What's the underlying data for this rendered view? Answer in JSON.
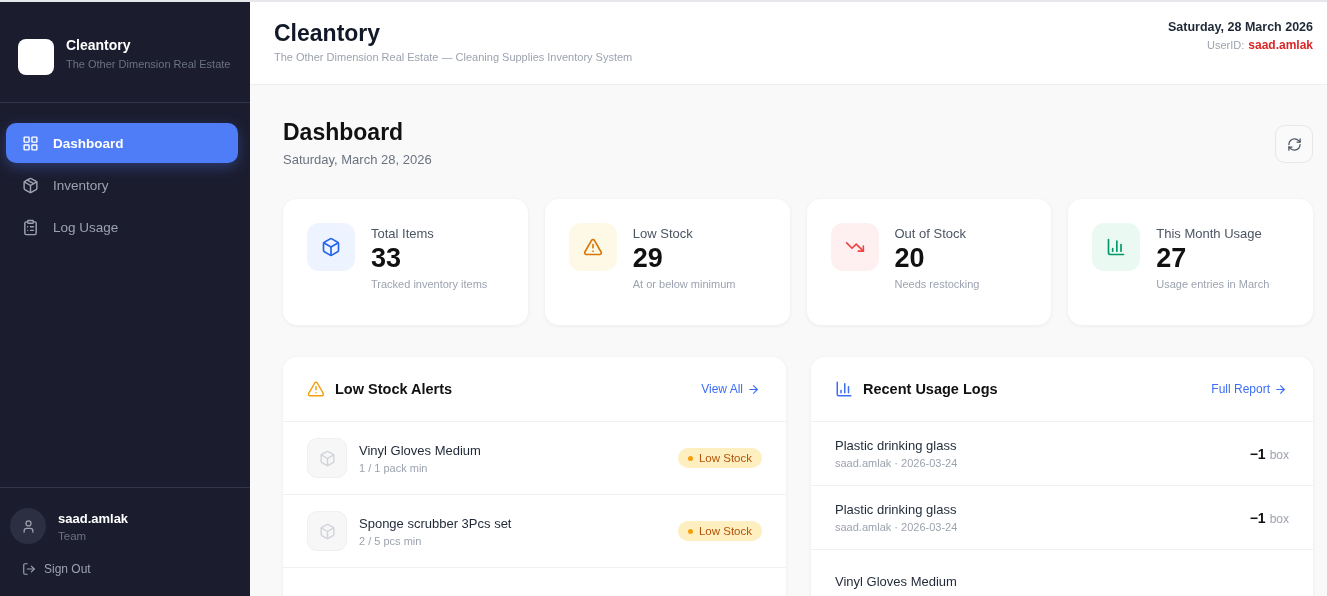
{
  "sidebar": {
    "brand": {
      "name": "Cleantory",
      "subtitle": "The Other Dimension Real Estate"
    },
    "items": [
      {
        "label": "Dashboard",
        "selected": true
      },
      {
        "label": "Inventory",
        "selected": false
      },
      {
        "label": "Log Usage",
        "selected": false
      }
    ],
    "user": {
      "name": "saad.amlak",
      "role": "Team"
    },
    "sign_out": "Sign Out"
  },
  "header": {
    "title": "Cleantory",
    "subtitle": "The Other Dimension Real Estate — Cleaning Supplies Inventory System",
    "date": "Saturday, 28 March 2026",
    "user_label": "UserID:",
    "user_id": "saad.amlak"
  },
  "page": {
    "title": "Dashboard",
    "date": "Saturday, March 28, 2026"
  },
  "stats": [
    {
      "kind": "box",
      "label": "Total Items",
      "value": "33",
      "note": "Tracked inventory items"
    },
    {
      "kind": "warning",
      "label": "Low Stock",
      "value": "29",
      "note": "At or below minimum"
    },
    {
      "kind": "trend",
      "label": "Out of Stock",
      "value": "20",
      "note": "Needs restocking"
    },
    {
      "kind": "chart",
      "label": "This Month Usage",
      "value": "27",
      "note": "Usage entries in March"
    }
  ],
  "alerts": {
    "title": "Low Stock Alerts",
    "link": "View All",
    "rows": [
      {
        "name": "Vinyl Gloves Medium",
        "detail": "1 / 1 pack min",
        "badge": "Low Stock"
      },
      {
        "name": "Sponge scrubber 3Pcs set",
        "detail": "2 / 5 pcs min",
        "badge": "Low Stock"
      }
    ]
  },
  "logs": {
    "title": "Recent Usage Logs",
    "link": "Full Report",
    "rows": [
      {
        "name": "Plastic drinking glass",
        "detail": "saad.amlak · 2026-03-24",
        "qty": "−1",
        "unit": "box"
      },
      {
        "name": "Plastic drinking glass",
        "detail": "saad.amlak · 2026-03-24",
        "qty": "−1",
        "unit": "box"
      },
      {
        "name": "Vinyl Gloves Medium"
      }
    ]
  }
}
